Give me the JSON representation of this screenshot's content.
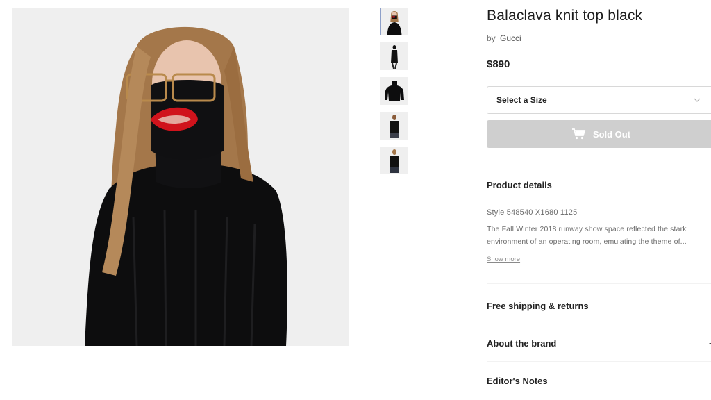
{
  "product": {
    "title": "Balaclava knit top black",
    "by_label": "by",
    "brand": "Gucci",
    "price": "$890"
  },
  "size_select": {
    "label": "Select a Size",
    "icon": "chevron-down-icon"
  },
  "buy_button": {
    "label": "Sold Out",
    "icon": "cart-icon",
    "state": "disabled"
  },
  "details": {
    "heading": "Product details",
    "style": "Style 548540 X1680 1125",
    "description": "The Fall Winter 2018 runway show space reflected the stark environment of an operating room, emulating the theme of...",
    "show_more": "Show more"
  },
  "accordions": [
    {
      "label": "Free shipping & returns",
      "icon": "+"
    },
    {
      "label": "About the brand",
      "icon": "+"
    },
    {
      "label": "Editor's Notes",
      "icon": "+"
    }
  ],
  "gallery": {
    "thumbnail_count": 5,
    "active_index": 0
  },
  "colors": {
    "background": "#ffffff",
    "image_bg": "#efefef",
    "sold_out_bg": "#cfcfcf",
    "text": "#1c1c1c",
    "muted": "#6b6b6b",
    "active_thumb_border": "#8ea0c9"
  }
}
